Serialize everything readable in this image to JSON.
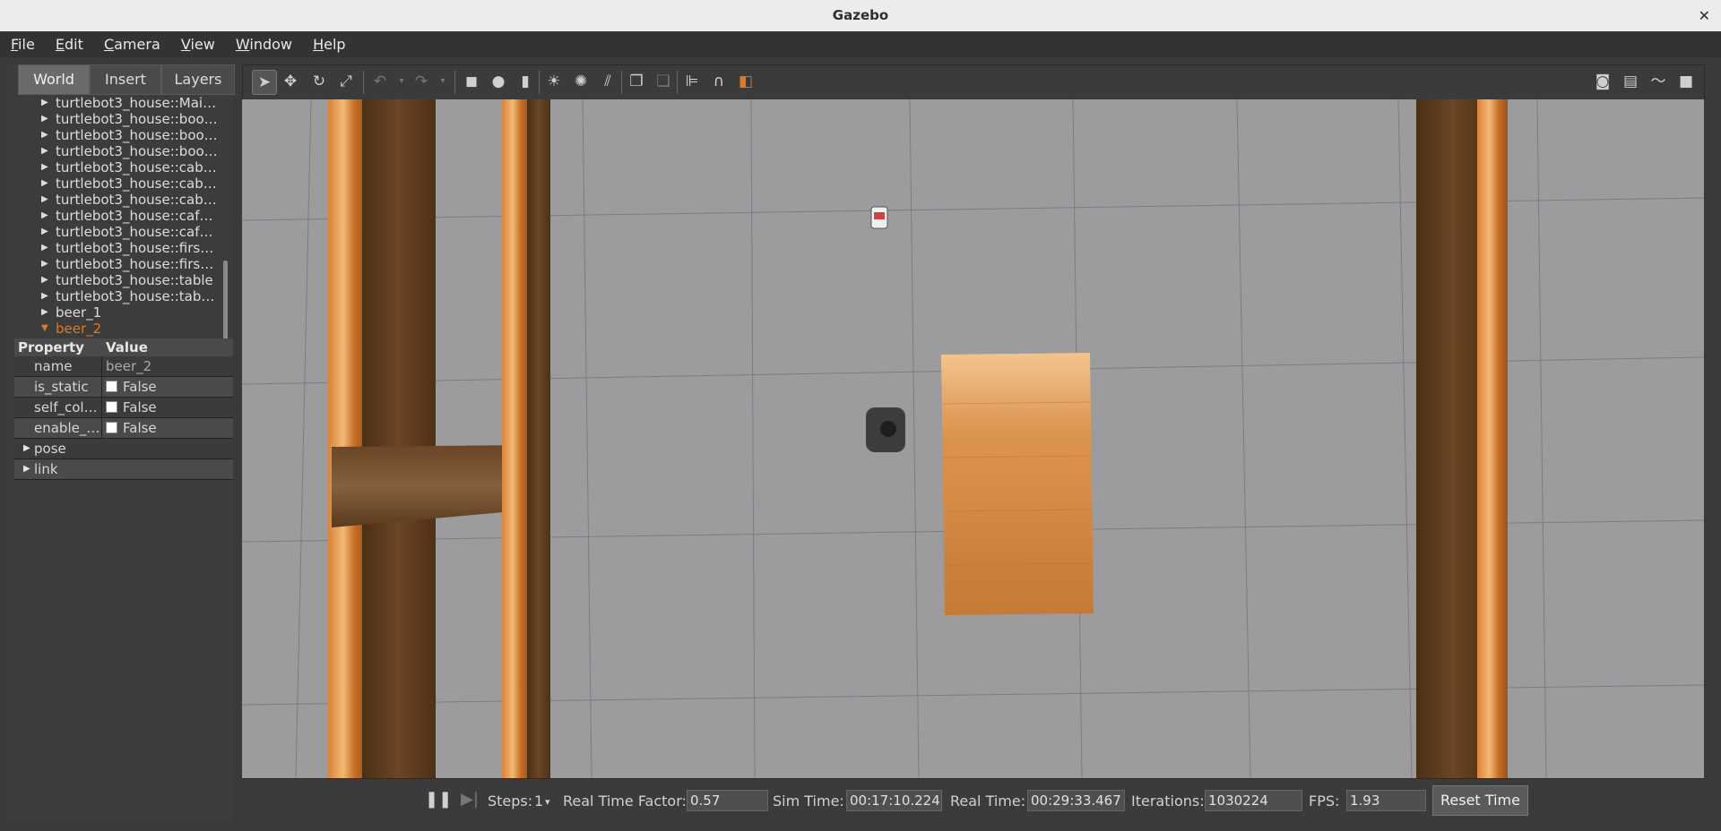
{
  "window": {
    "title": "Gazebo",
    "close_glyph": "✕"
  },
  "menu": [
    "File",
    "Edit",
    "Camera",
    "View",
    "Window",
    "Help"
  ],
  "left_panel": {
    "tabs": [
      "World",
      "Insert",
      "Layers"
    ],
    "active_tab": "World",
    "tree_items": [
      "turtlebot3_house::Mai…",
      "turtlebot3_house::boo…",
      "turtlebot3_house::boo…",
      "turtlebot3_house::boo…",
      "turtlebot3_house::cab…",
      "turtlebot3_house::cab…",
      "turtlebot3_house::cab…",
      "turtlebot3_house::caf…",
      "turtlebot3_house::caf…",
      "turtlebot3_house::firs…",
      "turtlebot3_house::firs…",
      "turtlebot3_house::table",
      "turtlebot3_house::tab…",
      "beer_1",
      "beer_2"
    ],
    "selected_item": "beer_2",
    "properties": {
      "header_property": "Property",
      "header_value": "Value",
      "rows": [
        {
          "key": "name",
          "value": "beer_2"
        },
        {
          "key": "is_static",
          "value": "False"
        },
        {
          "key": "self_col…",
          "value": "False"
        },
        {
          "key": "enable_…",
          "value": "False"
        },
        {
          "key": "pose",
          "value": ""
        },
        {
          "key": "link",
          "value": ""
        }
      ]
    }
  },
  "toolbar": {
    "icons": [
      "select-arrow-icon",
      "translate-icon",
      "rotate-icon",
      "scale-icon",
      "undo-icon",
      "redo-icon",
      "box-icon",
      "sphere-icon",
      "cylinder-icon",
      "point-light-icon",
      "spot-light-icon",
      "directional-light-icon",
      "copy-icon",
      "paste-icon",
      "align-icon",
      "snap-icon",
      "view-angle-icon",
      "screenshot-icon",
      "log-icon",
      "plot-icon",
      "video-record-icon"
    ]
  },
  "status": {
    "steps_label": "Steps:",
    "steps_value": "1",
    "rtf_label": "Real Time Factor:",
    "rtf_value": "0.57",
    "sim_time_label": "Sim Time:",
    "sim_time_value": "00:17:10.224",
    "real_time_label": "Real Time:",
    "real_time_value": "00:29:33.467",
    "iterations_label": "Iterations:",
    "iterations_value": "1030224",
    "fps_label": "FPS:",
    "fps_value": "1.93",
    "reset_button": "Reset Time"
  },
  "colors": {
    "selected_tree_item": "#e07a1f",
    "floor": "#9c9b9e",
    "wood_light": "#d98b3a",
    "wood_dark": "#5a3a1c"
  }
}
